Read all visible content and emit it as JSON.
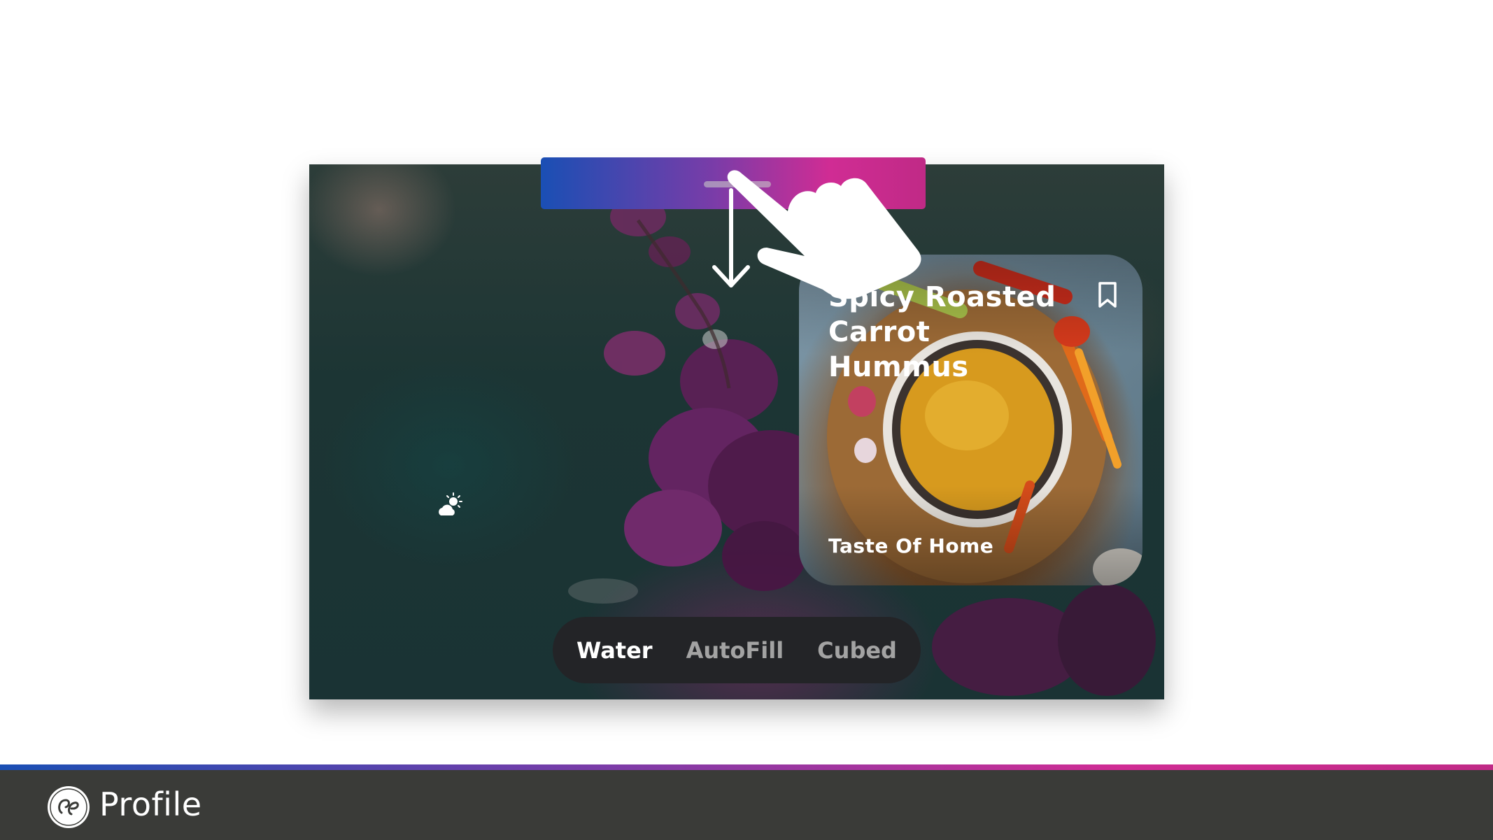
{
  "screen": {
    "background": "purple orchids on dark teal",
    "weather_icon": "partly-sunny-icon"
  },
  "recipe_card": {
    "title": "Spicy Roasted Carrot Hummus",
    "source": "Taste Of Home",
    "bookmark_icon": "bookmark-icon"
  },
  "gesture": {
    "hand_icon": "pointing-hand-icon",
    "arrow_icon": "down-arrow-icon"
  },
  "dispenser": {
    "options": [
      {
        "label": "Water",
        "active": true
      },
      {
        "label": "AutoFill",
        "active": false
      },
      {
        "label": "Cubed",
        "active": false
      }
    ]
  },
  "footer": {
    "logo_icon": "ge-monogram-icon",
    "brand": "Profile"
  },
  "colors": {
    "gradient_start": "#1a4fb4",
    "gradient_mid": "#7a3ca8",
    "gradient_end": "#d02c94",
    "footer_bg": "#3a3b38",
    "pill_bg": "#232427"
  }
}
